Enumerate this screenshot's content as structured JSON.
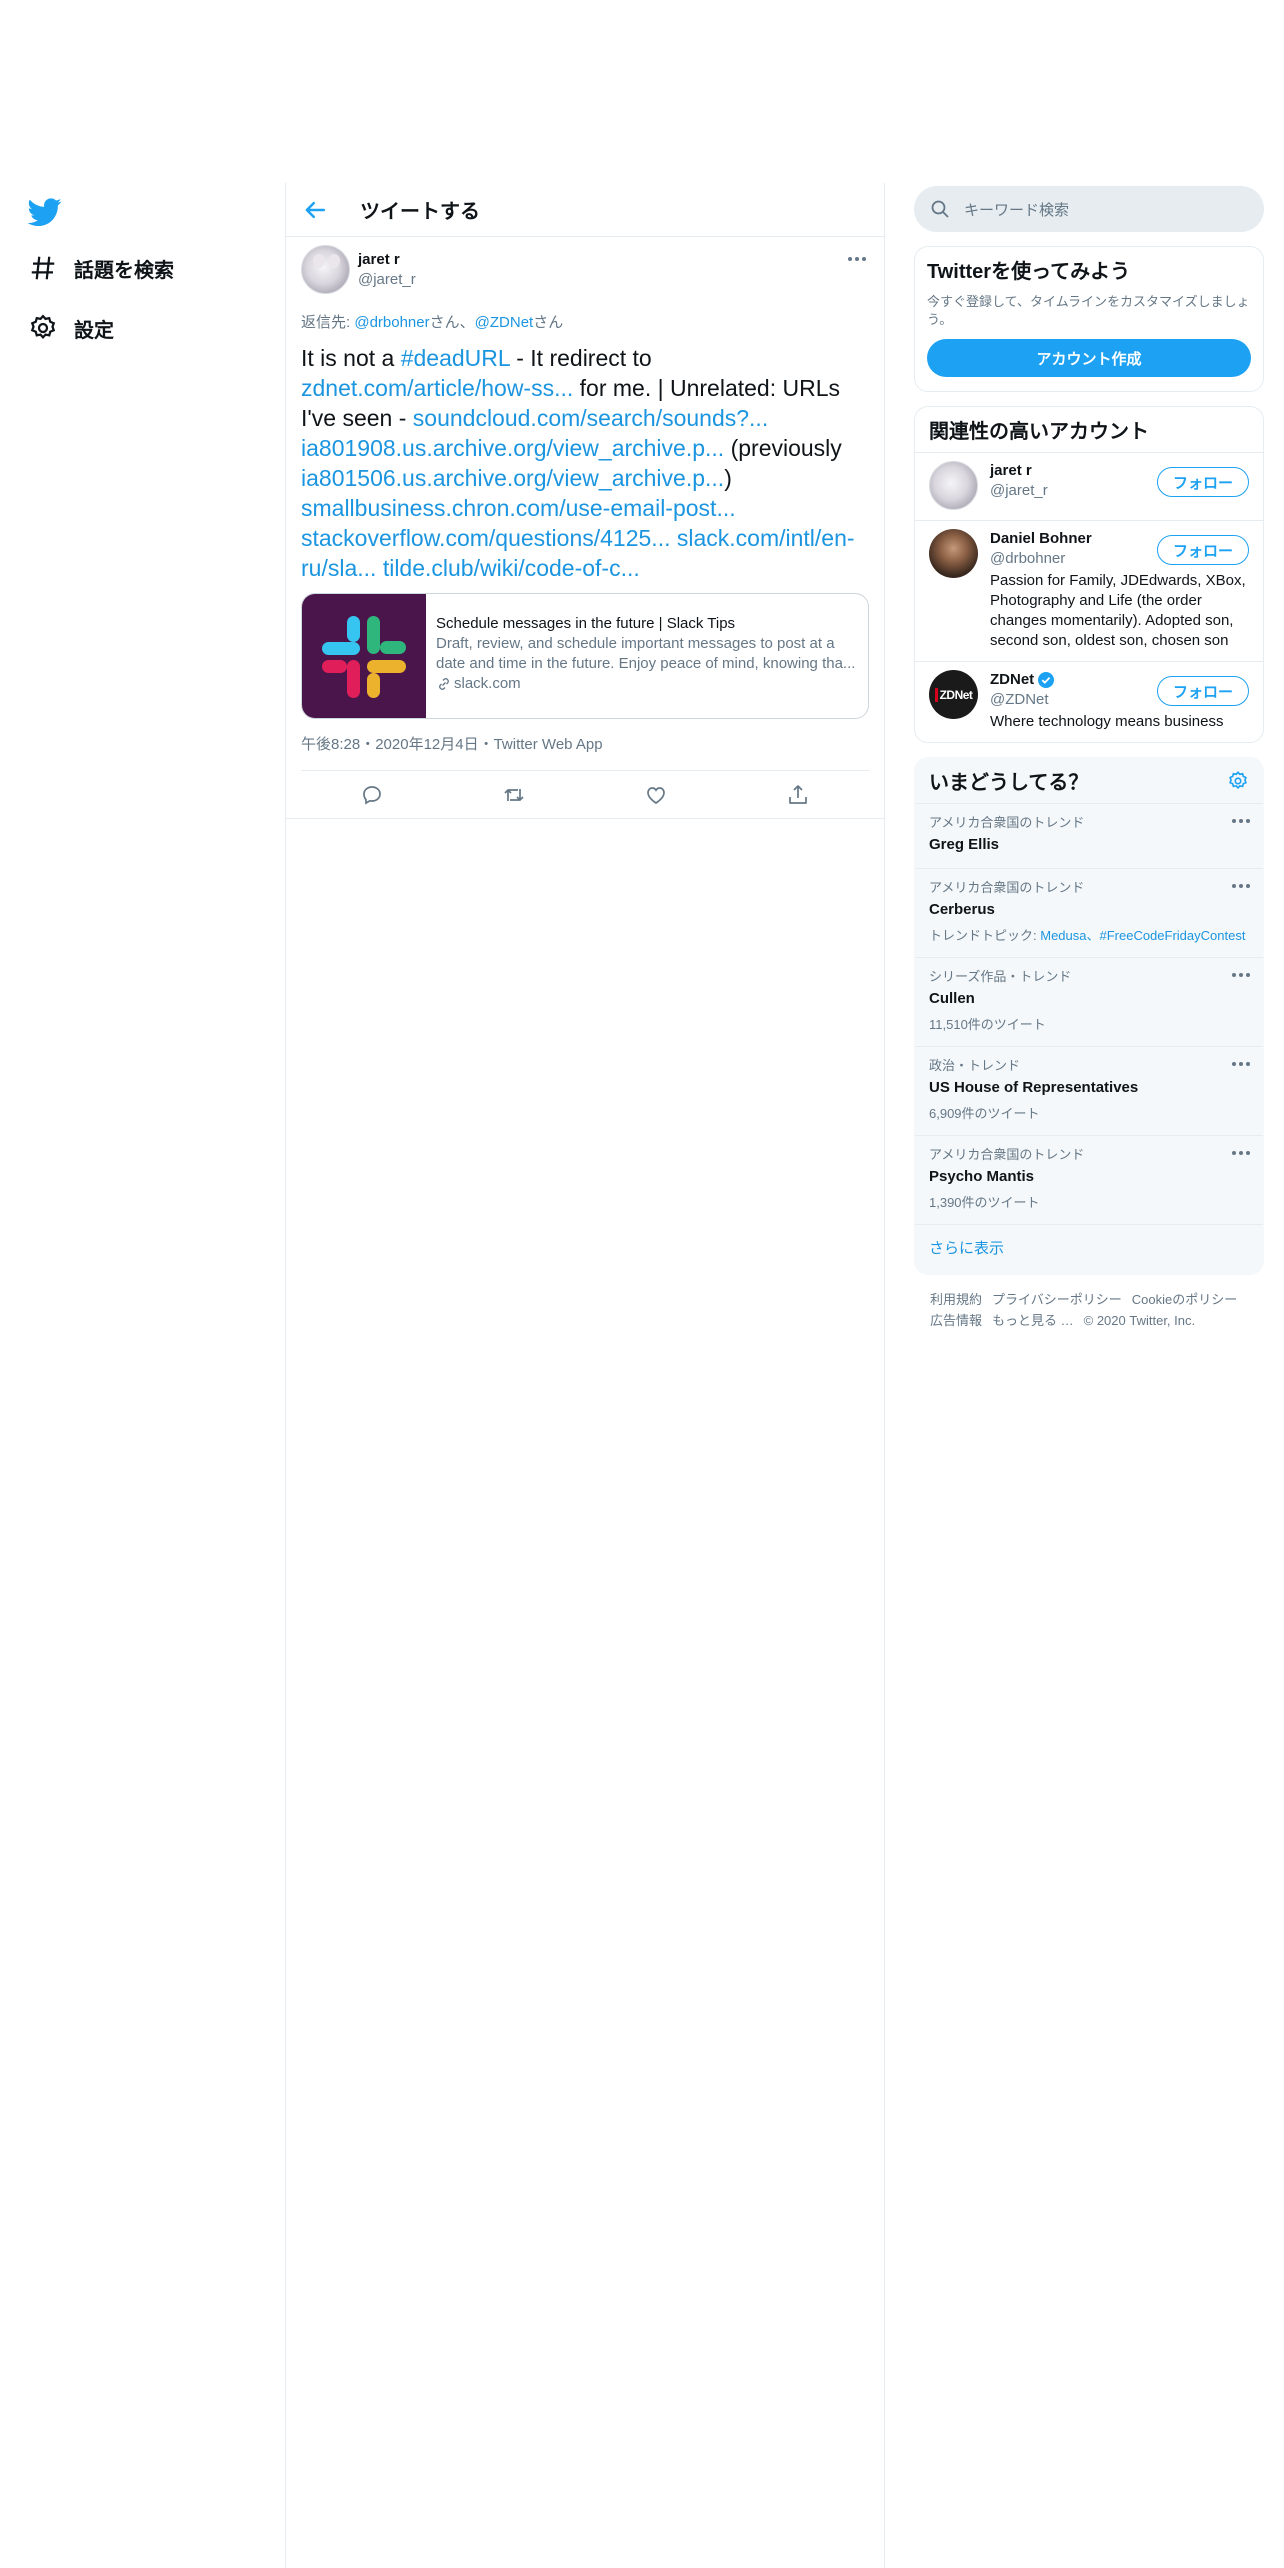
{
  "nav": {
    "explore_label": "話題を検索",
    "settings_label": "設定"
  },
  "header": {
    "title": "ツイートする"
  },
  "tweet": {
    "author_name": "jaret r",
    "author_handle": "@jaret_r",
    "reply_prefix": "返信先: ",
    "reply_user1": "@drbohner",
    "reply_sep": "さん、",
    "reply_user2": "@ZDNet",
    "reply_suffix": "さん",
    "text_1": "It is not a ",
    "hashtag": "#deadURL",
    "text_2": " - It redirect to ",
    "link_1": "zdnet.com/article/how-ss...",
    "text_3": " for me. | Unrelated: URLs I've seen - ",
    "link_2": "soundcloud.com/search/sounds?...",
    "link_3": "ia801908.us.archive.org/view_archive.p...",
    "text_4": " (previously ",
    "link_4": "ia801506.us.archive.org/view_archive.p...",
    "text_5": ") ",
    "link_5": "smallbusiness.chron.com/use-email-post...",
    "link_6": "stackoverflow.com/questions/4125...",
    "link_7": "slack.com/intl/en-ru/sla...",
    "link_8": "tilde.club/wiki/code-of-c...",
    "card": {
      "title": "Schedule messages in the future | Slack Tips",
      "description": "Draft, review, and schedule important messages to post at a date and time in the future. Enjoy peace of mind, knowing tha...",
      "domain": "slack.com"
    },
    "meta": "午後8:28・2020年12月4日・Twitter Web App"
  },
  "search": {
    "placeholder": "キーワード検索"
  },
  "signup": {
    "title": "Twitterを使ってみよう",
    "desc": "今すぐ登録して、タイムラインをカスタマイズしましょう。",
    "button": "アカウント作成"
  },
  "relevant": {
    "title": "関連性の高いアカウント",
    "follow_label": "フォロー",
    "accounts": [
      {
        "name": "jaret r",
        "handle": "@jaret_r",
        "bio": ""
      },
      {
        "name": "Daniel Bohner",
        "handle": "@drbohner",
        "bio": "Passion for Family, JDEdwards, XBox, Photography and Life (the order changes momentarily). Adopted son, second son, oldest son, chosen son"
      },
      {
        "name": "ZDNet",
        "handle": "@ZDNet",
        "bio": "Where technology means business",
        "avatar_text": "ZDNet"
      }
    ]
  },
  "trends": {
    "title": "いまどうしてる？",
    "items": [
      {
        "context": "アメリカ合衆国のトレンド",
        "name": "Greg Ellis",
        "extra": ""
      },
      {
        "context": "アメリカ合衆国のトレンド",
        "name": "Cerberus",
        "extra_prefix": "トレンドトピック: ",
        "extra_link": "Medusa、#FreeCodeFridayContest"
      },
      {
        "context": "シリーズ作品・トレンド",
        "name": "Cullen",
        "extra": "11,510件のツイート"
      },
      {
        "context": "政治・トレンド",
        "name": "US House of Representatives",
        "extra": "6,909件のツイート"
      },
      {
        "context": "アメリカ合衆国のトレンド",
        "name": "Psycho Mantis",
        "extra": "1,390件のツイート"
      }
    ],
    "show_more": "さらに表示"
  },
  "footer": {
    "links": [
      "利用規約",
      "プライバシーポリシー",
      "Cookieのポリシー",
      "広告情報",
      "もっと見る …"
    ],
    "copyright": "© 2020 Twitter, Inc."
  },
  "colors": {
    "accent": "#1da1f2",
    "link": "#1b95e0",
    "muted": "#657786",
    "border": "#e6ecf0"
  }
}
